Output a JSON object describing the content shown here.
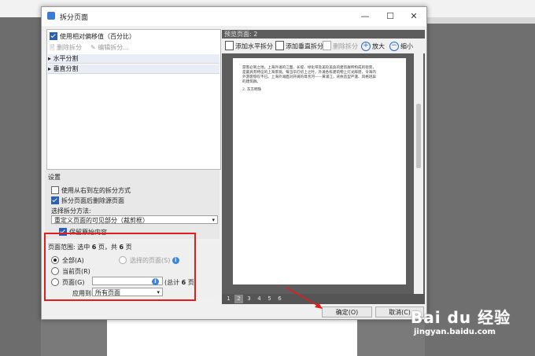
{
  "dialog": {
    "title": "拆分页面",
    "minimize": "—",
    "maximize": "☐",
    "close": "✕"
  },
  "left": {
    "relative_check_label": "使用相对偏移值（百分比）",
    "delete_split": "删除拆分",
    "edit_split": "编辑拆分...",
    "tree_items": [
      "水平分割",
      "垂直分割"
    ],
    "settings_label": "设置",
    "rtl_label": "使用从右到左的拆分方式",
    "delete_source_label": "拆分页面后删除源页面",
    "method_label": "选择拆分方法:",
    "method_value": "重定义页面的可见部分（裁剪框）",
    "keep_content_label": "保留原始内容"
  },
  "range": {
    "label_prefix": "页面范围: 选中",
    "selected_count": "6",
    "label_mid": "页，共",
    "total_count": "6",
    "label_suffix": "页",
    "all_label": "全部(A)",
    "selected_pages_label": "选择的页面(S)",
    "current_label": "当前页(R)",
    "pages_label": "页面(G)",
    "pages_value": "",
    "total_prefix": "(总计",
    "total_value": "6",
    "total_suffix": "页",
    "apply_label": "应用到:",
    "apply_value": "所有页面"
  },
  "preview": {
    "header": "预览页面: 2",
    "add_horizontal": "添加水平拆分",
    "add_vertical": "添加垂直拆分",
    "delete_split": "删除拆分",
    "zoom_in": "放大",
    "zoom_out": "缩小",
    "text_line1": "游客必到之地。上海外滩的江面、长堤、绿化带及美轮美奂的建筑群所构成的街景，",
    "text_line2": "是最具有特征的上海景观。每当华灯初上之时，外滩各栋建筑物上灯光辉煌，令海内",
    "text_line3": "外游客惊叹不已。上海外滩面对开阔的母亲河——黄浦江，背依造型严谨、风格迥异",
    "text_line4": "的建筑群。",
    "text_line5": "2. 东方明珠",
    "pages": [
      "1",
      "2",
      "3",
      "4",
      "5",
      "6"
    ],
    "selected_page": "2"
  },
  "buttons": {
    "ok": "确定(O)",
    "cancel": "取消(C)"
  },
  "watermark": {
    "brand": "Bai du 经验",
    "url": "jingyan.baidu.com"
  }
}
